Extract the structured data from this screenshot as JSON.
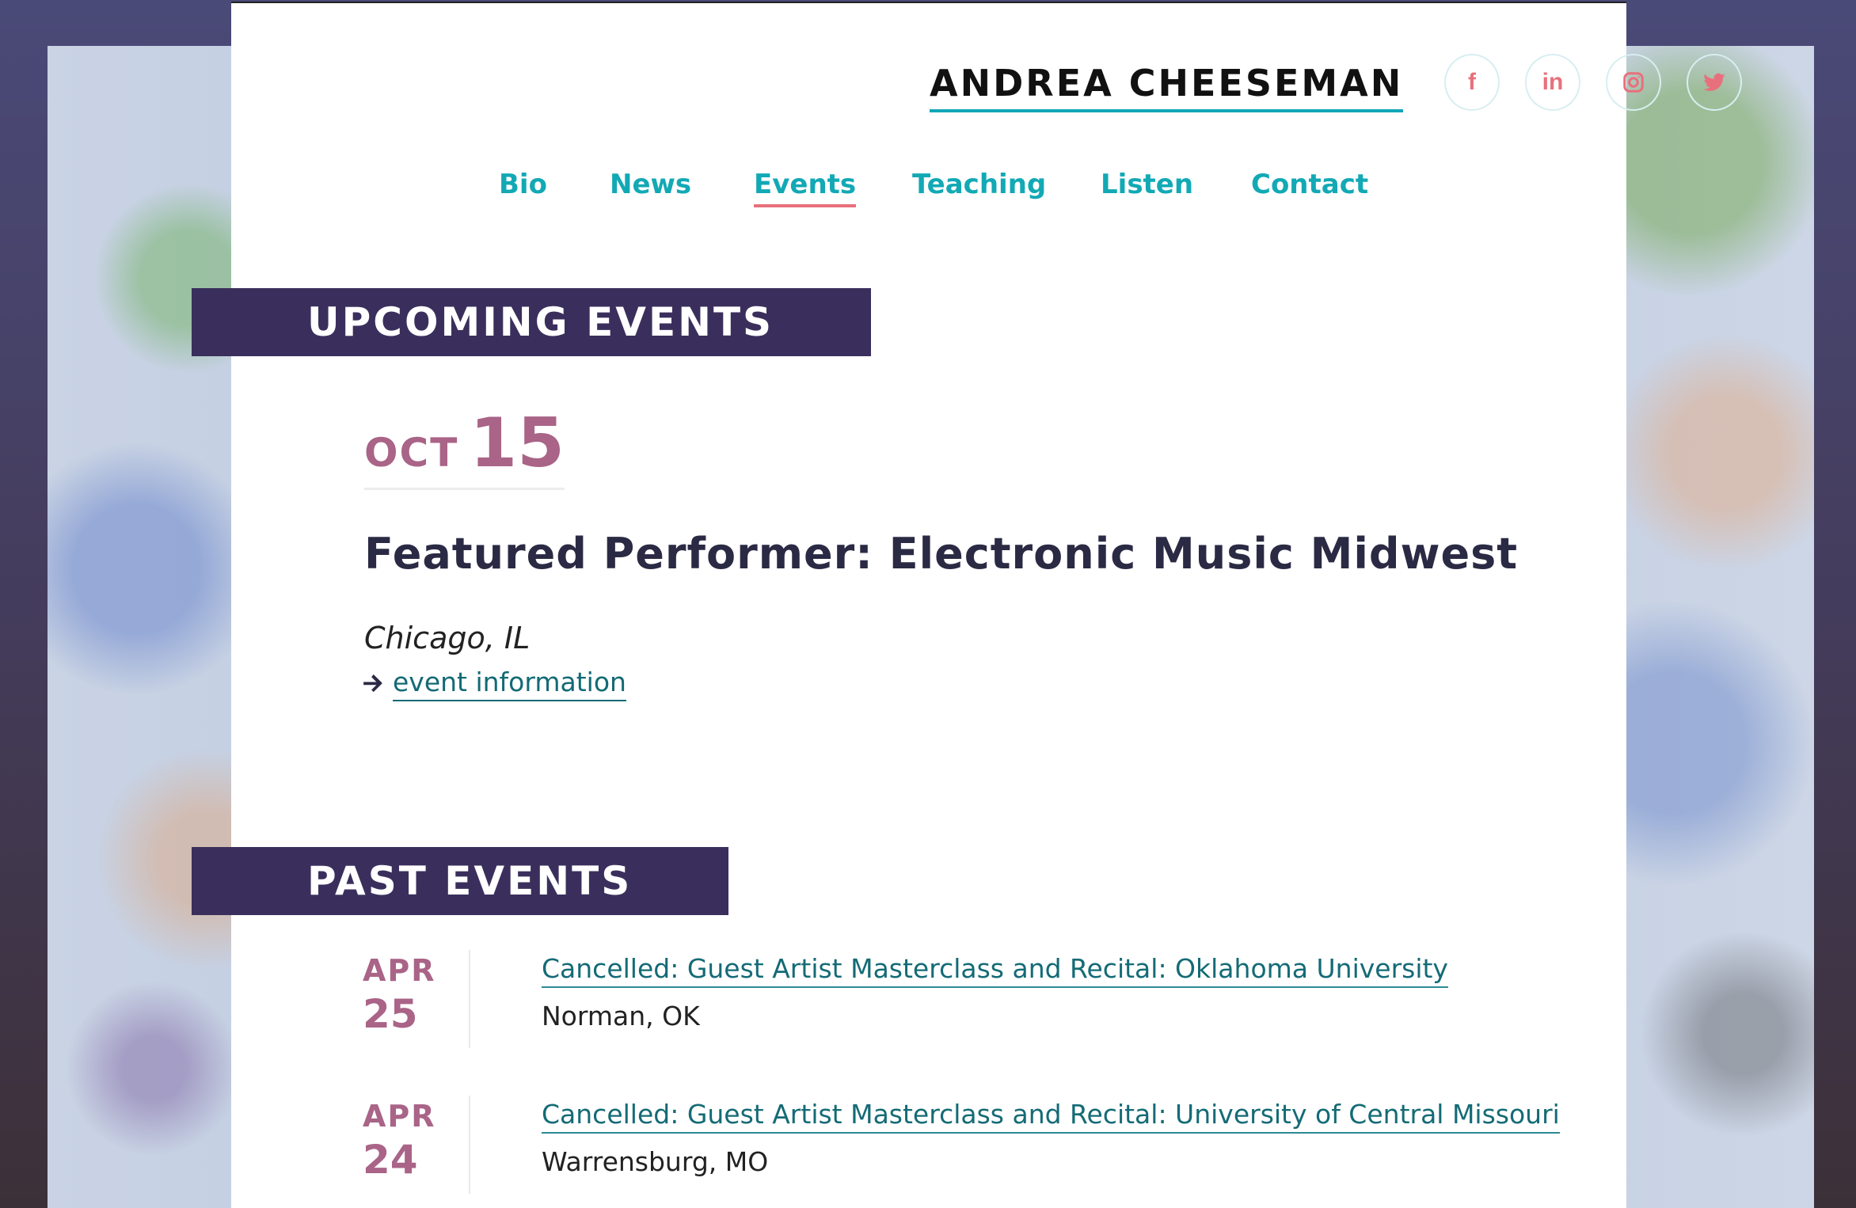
{
  "site": {
    "title": "ANDREA CHEESEMAN"
  },
  "socials": [
    {
      "name": "facebook",
      "glyph": "f"
    },
    {
      "name": "linkedin",
      "glyph": "in"
    },
    {
      "name": "instagram",
      "glyph": ""
    },
    {
      "name": "twitter",
      "glyph": ""
    }
  ],
  "nav": {
    "items": [
      {
        "label": "Bio"
      },
      {
        "label": "News"
      },
      {
        "label": "Events",
        "active": true
      },
      {
        "label": "Teaching"
      },
      {
        "label": "Listen"
      },
      {
        "label": "Contact"
      }
    ]
  },
  "upcoming": {
    "heading": "UPCOMING EVENTS",
    "event": {
      "month": "OCT",
      "day": "15",
      "title": "Featured Performer: Electronic Music Midwest",
      "place": "Chicago, IL",
      "link_label": "event information"
    }
  },
  "past": {
    "heading": "PAST EVENTS",
    "events": [
      {
        "month": "APR",
        "day": "25",
        "title": "Cancelled: Guest Artist Masterclass and Recital: Oklahoma University",
        "place": "Norman, OK"
      },
      {
        "month": "APR",
        "day": "24",
        "title": "Cancelled: Guest Artist Masterclass and Recital: University of Central Missouri",
        "place": "Warrensburg, MO"
      }
    ]
  },
  "colors": {
    "accent_teal": "#12a9b5",
    "banner_purple": "#3a2f5c",
    "date_mauve": "#a96487",
    "social_pink": "#e8707c"
  }
}
